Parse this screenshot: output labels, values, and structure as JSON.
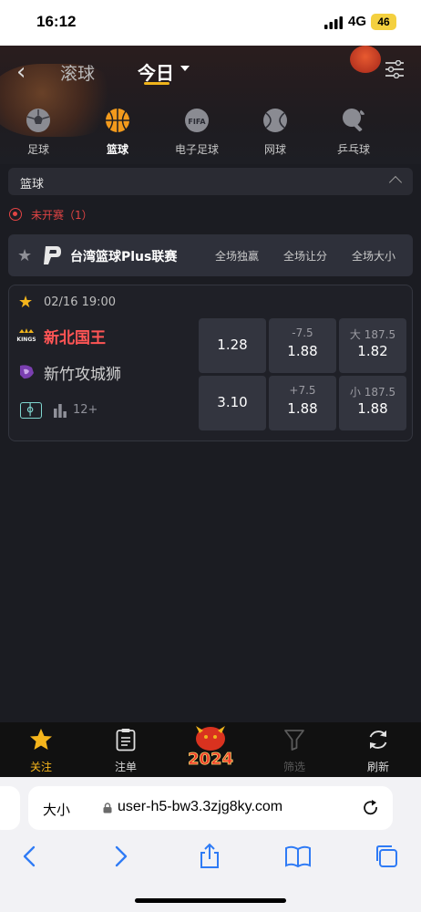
{
  "status_bar": {
    "time": "16:12",
    "network": "4G",
    "battery": "46"
  },
  "header": {
    "tab_live": "滚球",
    "tab_today": "今日",
    "sports": [
      {
        "label": "足球",
        "icon": "soccer-ball-icon"
      },
      {
        "label": "篮球",
        "icon": "basketball-icon",
        "active": true
      },
      {
        "label": "电子足球",
        "icon": "fifa-icon",
        "badge": "FIFA"
      },
      {
        "label": "网球",
        "icon": "tennis-ball-icon"
      },
      {
        "label": "乒乓球",
        "icon": "ping-pong-icon"
      }
    ]
  },
  "section": {
    "title": "篮球"
  },
  "status": {
    "label": "未开赛（1）"
  },
  "league": {
    "name": "台湾篮球Plus联赛",
    "columns": [
      "全场独赢",
      "全场让分",
      "全场大小"
    ]
  },
  "match": {
    "datetime": "02/16 19:00",
    "home": {
      "name": "新北国王",
      "logo_text": "KINGS"
    },
    "away": {
      "name": "新竹攻城狮"
    },
    "more_markets": "12+",
    "odds": {
      "home": [
        {
          "line": "",
          "price": "1.28"
        },
        {
          "line": "-7.5",
          "price": "1.88"
        },
        {
          "line": "大 187.5",
          "price": "1.82"
        }
      ],
      "away": [
        {
          "line": "",
          "price": "3.10"
        },
        {
          "line": "+7.5",
          "price": "1.88"
        },
        {
          "line": "小 187.5",
          "price": "1.88"
        }
      ]
    }
  },
  "bottom_nav": {
    "items": [
      {
        "label": "关注",
        "icon": "star-icon",
        "active": true
      },
      {
        "label": "注单",
        "icon": "clipboard-icon"
      },
      {
        "label": "2024",
        "icon": "dragon-2024-logo"
      },
      {
        "label": "筛选",
        "icon": "filter-icon",
        "disabled": true
      },
      {
        "label": "刷新",
        "icon": "refresh-icon"
      }
    ]
  },
  "browser": {
    "text_size": "大小",
    "url": "user-h5-bw3.3zjg8ky.com"
  },
  "colors": {
    "accent": "#f5b51c",
    "alert": "#e24444",
    "home_team": "#ff5555",
    "background": "#1b1c22"
  }
}
